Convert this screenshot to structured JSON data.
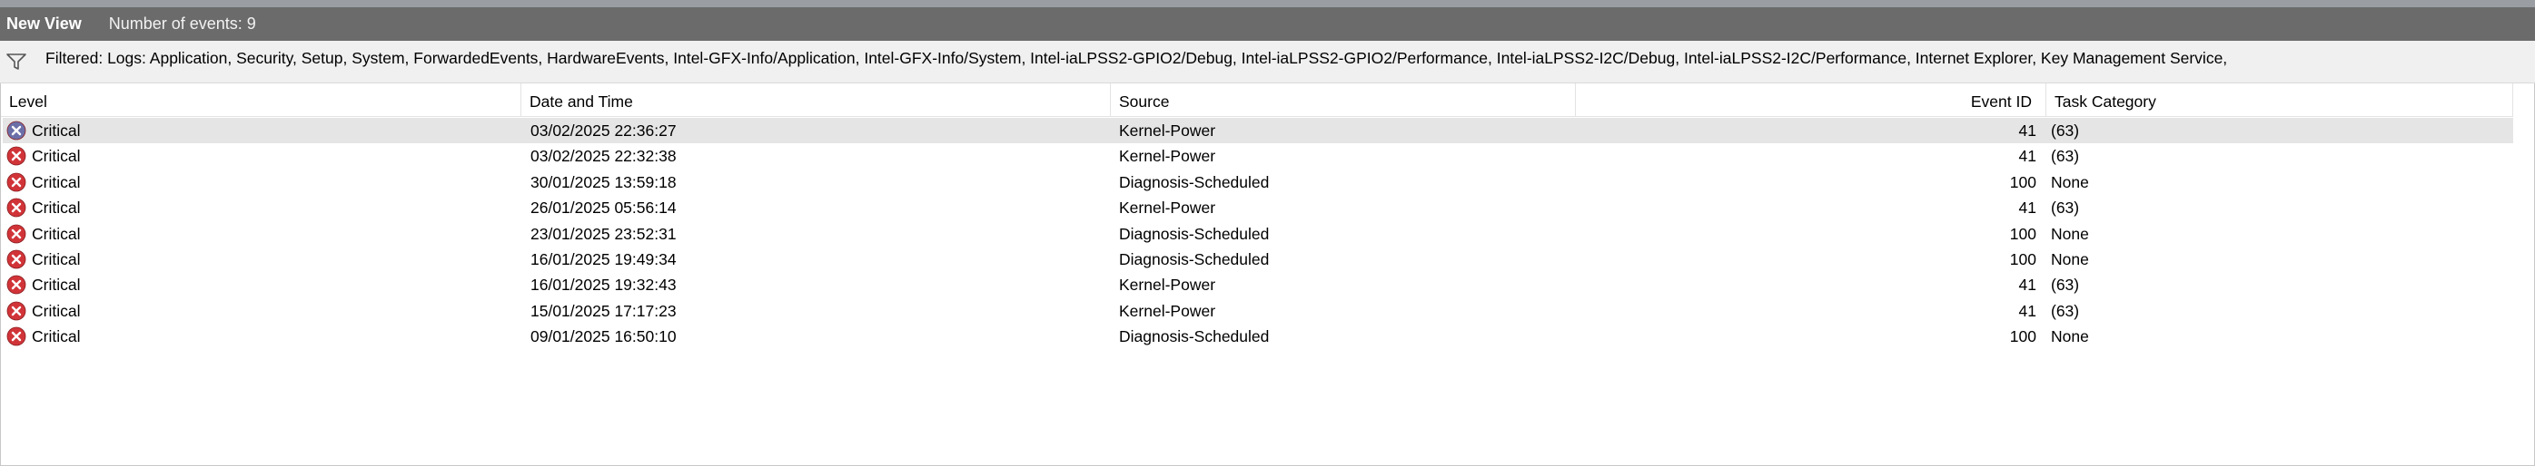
{
  "view": {
    "title": "New View",
    "event_count": "Number of events: 9"
  },
  "filter": {
    "icon": "funnel-icon",
    "text": "Filtered: Logs: Application, Security, Setup, System, ForwardedEvents, HardwareEvents, Intel-GFX-Info/Application, Intel-GFX-Info/System, Intel-iaLPSS2-GPIO2/Debug, Intel-iaLPSS2-GPIO2/Performance, Intel-iaLPSS2-I2C/Debug, Intel-iaLPSS2-I2C/Performance, Internet Explorer, Key Management Service,"
  },
  "columns": {
    "level": "Level",
    "date": "Date and Time",
    "source": "Source",
    "event_id": "Event ID",
    "task": "Task Category"
  },
  "colors": {
    "critical_icon": "#d13438",
    "selected_icon": "#6b6fa8",
    "title_bar": "#6b6b6b",
    "selected_row": "#e5e5e5"
  },
  "events": [
    {
      "level": "Critical",
      "date": "03/02/2025 22:36:27",
      "source": "Kernel-Power",
      "event_id": "41",
      "task": "(63)",
      "selected": true
    },
    {
      "level": "Critical",
      "date": "03/02/2025 22:32:38",
      "source": "Kernel-Power",
      "event_id": "41",
      "task": "(63)"
    },
    {
      "level": "Critical",
      "date": "30/01/2025 13:59:18",
      "source": "Diagnosis-Scheduled",
      "event_id": "100",
      "task": "None"
    },
    {
      "level": "Critical",
      "date": "26/01/2025 05:56:14",
      "source": "Kernel-Power",
      "event_id": "41",
      "task": "(63)"
    },
    {
      "level": "Critical",
      "date": "23/01/2025 23:52:31",
      "source": "Diagnosis-Scheduled",
      "event_id": "100",
      "task": "None"
    },
    {
      "level": "Critical",
      "date": "16/01/2025 19:49:34",
      "source": "Diagnosis-Scheduled",
      "event_id": "100",
      "task": "None"
    },
    {
      "level": "Critical",
      "date": "16/01/2025 19:32:43",
      "source": "Kernel-Power",
      "event_id": "41",
      "task": "(63)"
    },
    {
      "level": "Critical",
      "date": "15/01/2025 17:17:23",
      "source": "Kernel-Power",
      "event_id": "41",
      "task": "(63)"
    },
    {
      "level": "Critical",
      "date": "09/01/2025 16:50:10",
      "source": "Diagnosis-Scheduled",
      "event_id": "100",
      "task": "None"
    }
  ]
}
